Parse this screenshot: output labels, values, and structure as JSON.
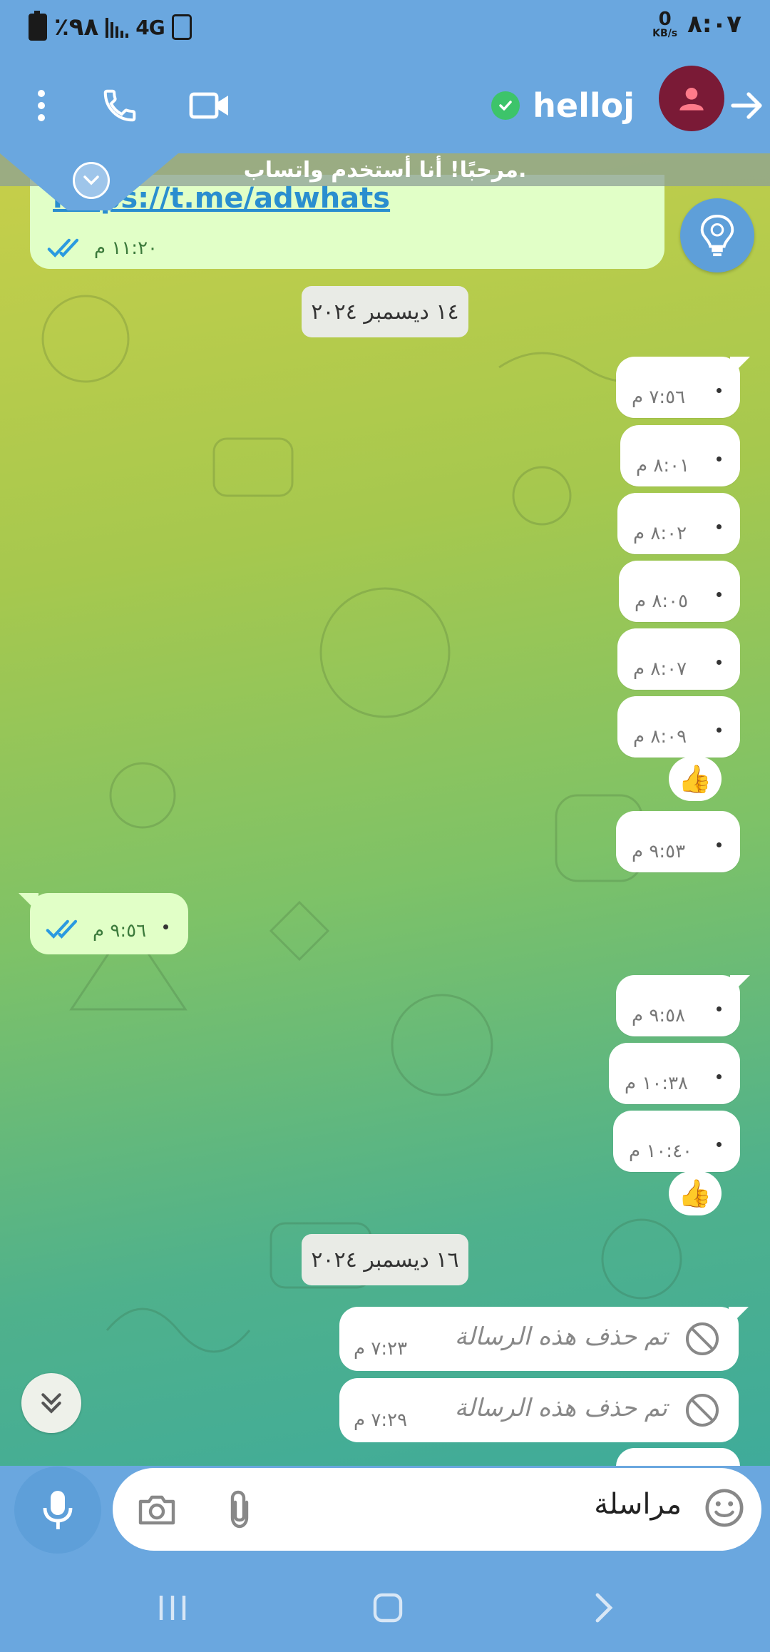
{
  "status_bar": {
    "battery": "٪٩٨",
    "network": "4G",
    "speed_value": "0",
    "speed_unit": "KB/s",
    "time": "٨:٠٧"
  },
  "header": {
    "contact_name": "helloj",
    "icons": [
      "back-arrow-icon",
      "avatar-person-icon",
      "verified-icon",
      "video-call-icon",
      "voice-call-icon",
      "more-vertical-icon"
    ]
  },
  "pinned": {
    "text": "مرحبًا! أنا أستخدم واتساب."
  },
  "link_message": {
    "link": "https://t.me/adwhats",
    "time": "١١:٢٠ م"
  },
  "dates": {
    "first": "١٤ ديسمبر ٢٠٢٤",
    "second": "١٦ ديسمبر ٢٠٢٤"
  },
  "outgoing_messages": [
    {
      "time": "٧:٥٦ م"
    },
    {
      "time": "٨:٠١ م"
    },
    {
      "time": "٨:٠٢ م"
    },
    {
      "time": "٨:٠٥ م"
    },
    {
      "time": "٨:٠٧ م"
    },
    {
      "time": "٨:٠٩ م",
      "reaction": "👍"
    },
    {
      "time": "٩:٥٣ م"
    }
  ],
  "incoming_message": {
    "time": "٩:٥٦ م"
  },
  "outgoing_messages_2": [
    {
      "time": "٩:٥٨ م"
    },
    {
      "time": "١٠:٣٨ م"
    },
    {
      "time": "١٠:٤٠ م",
      "reaction": "👍"
    }
  ],
  "deleted_messages": [
    {
      "text": "تم حذف هذه الرسالة",
      "time": "٧:٢٣ م"
    },
    {
      "text": "تم حذف هذه الرسالة",
      "time": "٧:٢٩ م"
    }
  ],
  "composer": {
    "placeholder": "مراسلة"
  },
  "colors": {
    "header": "#6aa7df",
    "bubble_out": "#ffffff",
    "bubble_in": "#e1ffc7",
    "link": "#2a8ecf",
    "accent": "#5e9fd9"
  }
}
